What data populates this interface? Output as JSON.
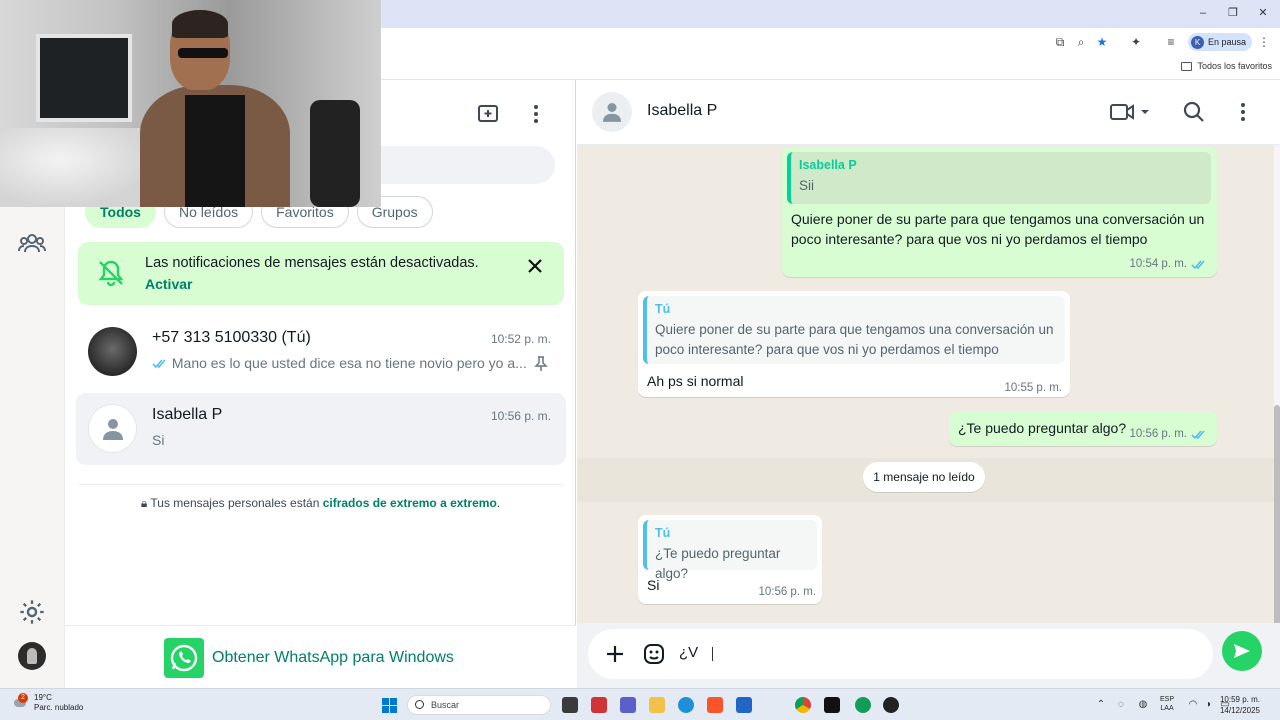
{
  "browser": {
    "profile_initial": "K",
    "profile_status": "En pausa",
    "bookmarks_all": "Todos los favoritos"
  },
  "filters": [
    "Todos",
    "No leídos",
    "Favoritos",
    "Grupos"
  ],
  "notification": {
    "title": "Las notificaciones de mensajes están desactivadas.",
    "action": "Activar"
  },
  "chats": [
    {
      "name": "+57 313 5100330 (Tú)",
      "time": "10:52 p. m.",
      "preview": "Mano es lo que usted dice esa no tiene novio pero yo a..."
    },
    {
      "name": "Isabella P",
      "time": "10:56 p. m.",
      "preview": "Si"
    }
  ],
  "encryption": {
    "prefix": "Tus mensajes personales están ",
    "link": "cifrados de extremo a extremo",
    "suffix": "."
  },
  "get_app": "Obtener WhatsApp para Windows",
  "conversation": {
    "contact": "Isabella P",
    "messages": [
      {
        "quote_author": "Isabella P",
        "quote_text": "Sii",
        "text": "Quiere poner de su parte para que tengamos una conversación un poco interesante? para que vos ni yo perdamos el tiempo",
        "time": "10:54 p. m."
      },
      {
        "quote_author": "Tú",
        "quote_text": "Quiere poner de su parte para que tengamos una conversación un poco interesante? para que vos ni yo perdamos el tiempo",
        "text": "Ah ps si normal",
        "time": "10:55 p. m."
      },
      {
        "text": "¿Te puedo preguntar algo?",
        "time": "10:56 p. m."
      },
      {
        "quote_author": "Tú",
        "quote_text": "¿Te puedo preguntar algo?",
        "text": "Si",
        "time": "10:56 p. m."
      }
    ],
    "unread": "1 mensaje no leído",
    "draft": "¿V"
  },
  "taskbar": {
    "weather_badge": "2",
    "temperature": "19°C",
    "weather": "Parc. nublado",
    "search": "Buscar",
    "lang_top": "ESP",
    "lang_bottom": "LAA",
    "time": "10:59 p. m.",
    "date": "14/12/2025"
  },
  "colors": {
    "accent_green": "#25d366",
    "wa_teal": "#008069",
    "outgoing_bubble": "#d9fdd3",
    "read_ticks": "#53bdeb"
  }
}
